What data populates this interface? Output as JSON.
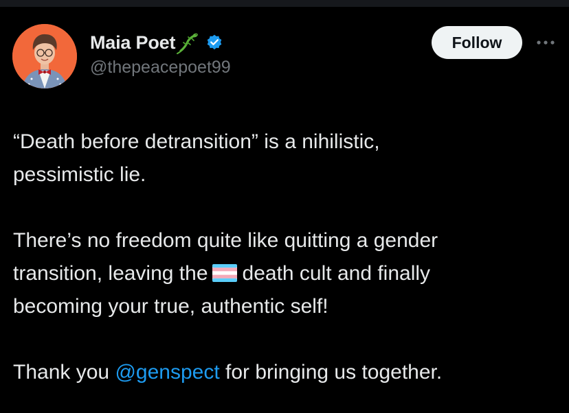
{
  "author": {
    "display_name": "Maia Poet",
    "name_emoji": "lizard-emoji",
    "verified_badge": "verified-badge-icon",
    "handle": "@thepeacepoet99"
  },
  "actions": {
    "follow_label": "Follow",
    "more_icon": "more-horizontal-icon"
  },
  "tweet": {
    "line1": "“Death before detransition” is a nihilistic,",
    "line2": "pessimistic lie.",
    "line3": "There’s no freedom quite like quitting a gender",
    "line4_before": "transition, leaving the",
    "line4_emoji": "transgender-flag-emoji",
    "line4_after": "death cult and finally",
    "line5": "becoming your true, authentic self!",
    "line6_before": "Thank you",
    "mention": "@genspect",
    "line6_after": "for bringing us together."
  },
  "colors": {
    "background": "#000000",
    "text": "#e7e9ea",
    "secondary_text": "#71767b",
    "link": "#1d9bf0",
    "verified": "#1d9bf0",
    "follow_bg": "#eff3f4",
    "avatar_bg": "#f2683a"
  }
}
